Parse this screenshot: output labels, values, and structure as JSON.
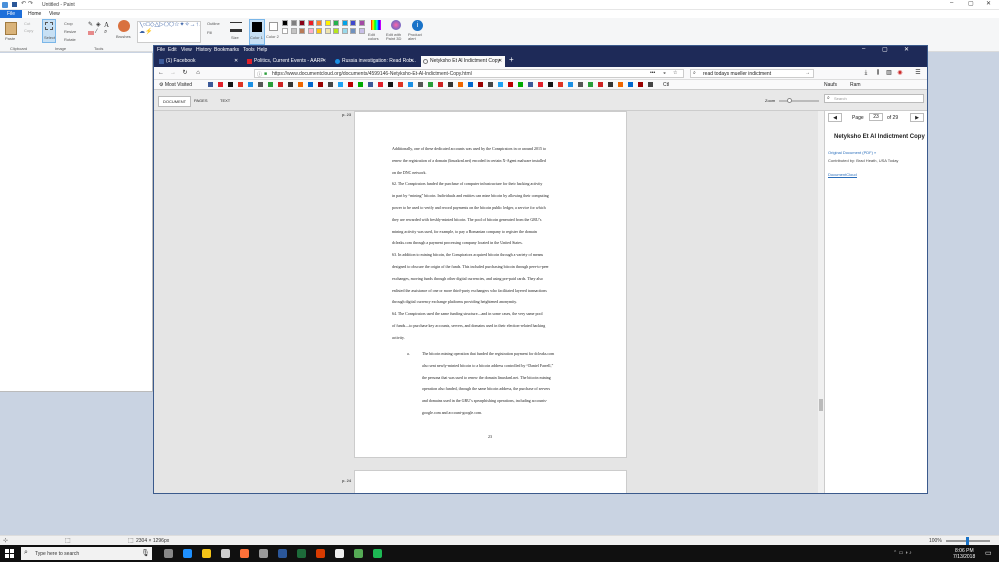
{
  "paint": {
    "title": "Untitled - Paint",
    "tabs": [
      "File",
      "Home",
      "View"
    ],
    "groups": {
      "clipboard": "Clipboard",
      "image": "Image",
      "tools": "Tools"
    },
    "buttons": {
      "paste": "Paste",
      "cut": "Cut",
      "copy": "Copy",
      "select": "Select",
      "crop": "Crop",
      "resize": "Resize",
      "rotate": "Rotate",
      "brushes": "Brushes",
      "outline": "Outline",
      "fill": "Fill",
      "size": "Size",
      "color1": "Color 1",
      "color2": "Color 2",
      "edit_colors": "Edit colors",
      "edit_paint3d": "Edit with Paint 3D",
      "product_alert": "Product alert"
    },
    "palette": [
      "#000000",
      "#7f7f7f",
      "#880015",
      "#ed1c24",
      "#ff7f27",
      "#fff200",
      "#22b14c",
      "#00a2e8",
      "#3f48cc",
      "#a349a4",
      "#ffffff",
      "#c3c3c3",
      "#b97a57",
      "#ffaec9",
      "#ffc90e",
      "#efe4b0",
      "#b5e61d",
      "#99d9ea",
      "#7092be",
      "#c8bfe7"
    ],
    "status": {
      "dimensions": "2304 × 1296px",
      "zoom": "100%"
    }
  },
  "firefox": {
    "menu": [
      "File",
      "Edit",
      "View",
      "History",
      "Bookmarks",
      "Tools",
      "Help"
    ],
    "tabs": [
      {
        "label": "(1) Facebook"
      },
      {
        "label": "Politics, Current Events - AARP"
      },
      {
        "label": "Russia investigation: Read Rob..."
      },
      {
        "label": "Netyksho Et Al Indictment Copy"
      }
    ],
    "url": "https://www.documentcloud.org/documents/4599146-Netyksho-Et-Al-Indictment-Copy.html",
    "search_value": "read todays mueller indictment",
    "bookmarks": {
      "most_visited": "Most Visited",
      "ctl": "Ctl",
      "naufs": "Naufs",
      "ram": "Ram"
    }
  },
  "dc": {
    "tabs": [
      "DOCUMENT",
      "PAGES",
      "TEXT"
    ],
    "zoom_label": "Zoom",
    "search_placeholder": "Search",
    "page_label": "Page",
    "page_current": "23",
    "page_total": "of 29",
    "title": "Netyksho Et Al Indictment Copy",
    "original_link": "Original Document (PDF) »",
    "contributed": "Contributed by: Brad Heath, USA Today",
    "brand": "DocumentCloud"
  },
  "document": {
    "page_marker": "p. 23",
    "next_page_marker": "p. 24",
    "lines": [
      "Additionally, one of these dedicated accounts was used by the Conspirators in or around 2015 to",
      "renew the registration of a domain (linuxkrnl.net) encoded in certain X-Agent malware installed",
      "on the DNC network.",
      "62.     The Conspirators funded the purchase of computer infrastructure for their hacking activity",
      "in part by “mining” bitcoin.  Individuals and entities can mine bitcoin by allowing their computing",
      "power to be used to verify and record payments on the bitcoin public ledger, a service for which",
      "they are rewarded with freshly-minted bitcoin.  The pool of bitcoin generated from the GRU’s",
      "mining activity was used, for example, to pay a Romanian company to register the domain",
      "dcleaks.com through a payment processing company located in the United States.",
      "63.     In addition to mining bitcoin, the Conspirators acquired bitcoin through a variety of means",
      "designed to obscure the origin of the funds.  This included purchasing bitcoin through peer-to-peer",
      "exchanges, moving funds through other digital currencies, and using pre-paid cards.  They also",
      "enlisted the assistance of one or more third-party exchangers who facilitated layered transactions",
      "through digital currency exchange platforms providing heightened anonymity.",
      "64.     The Conspirators used the same funding structure—and in some cases, the very same pool",
      "of funds—to purchase key accounts, servers, and domains used in their election-related hacking",
      "activity."
    ],
    "sub_marker": "a.",
    "sub_lines": [
      "The bitcoin mining operation that funded the registration payment for dcleaks.com",
      "also sent newly-minted bitcoin to a bitcoin address controlled by “Daniel Farrell,”",
      "the persona that was used to renew the domain linuxkrnl.net.  The bitcoin mining",
      "operation also funded, through the same bitcoin address, the purchase of servers",
      "and domains used in the GRU’s spearphishing operations, including accounts-",
      "google.com and account-google.com."
    ],
    "page_number": "23"
  },
  "taskbar": {
    "search_placeholder": "Type here to search",
    "time": "8:06 PM",
    "date": "7/13/2018"
  }
}
